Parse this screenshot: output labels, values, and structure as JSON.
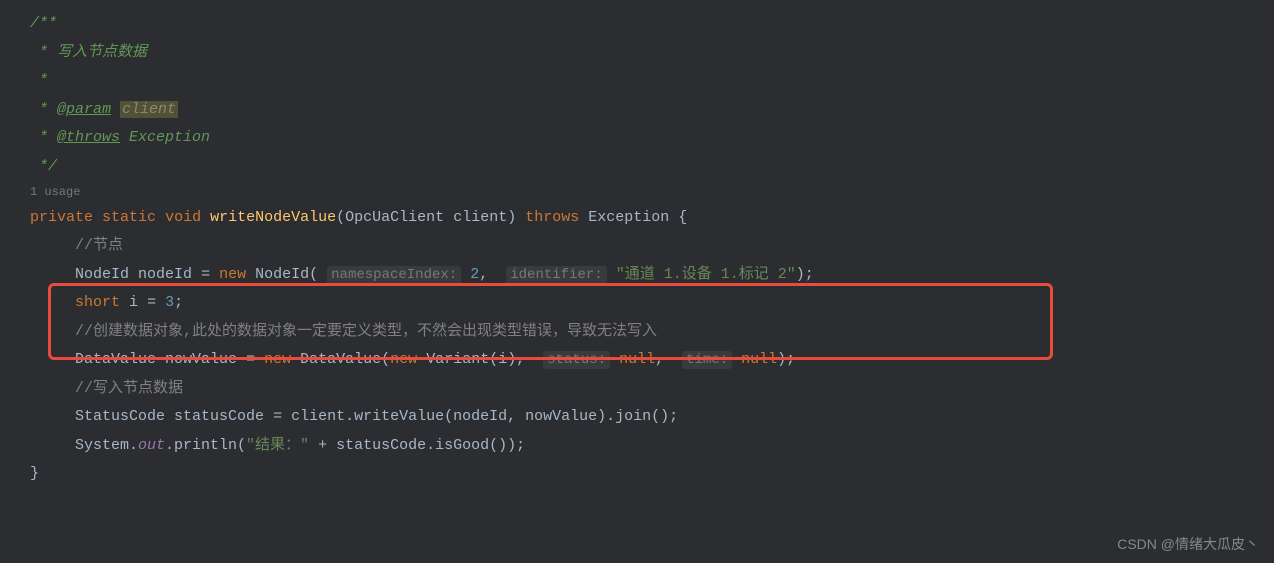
{
  "doc": {
    "open": "/**",
    "line1_star": " * ",
    "line1_text": "写入节点数据",
    "line2_star": " *",
    "line3_star": " * ",
    "param_tag": "@param",
    "param_name": "client",
    "line4_star": " * ",
    "throws_tag": "@throws",
    "throws_name": "Exception",
    "close": " */"
  },
  "usage": "1 usage",
  "method_sig": {
    "private": "private",
    "static": "static",
    "void": "void",
    "name": "writeNodeValue",
    "paren_open": "(",
    "param_type": "OpcUaClient",
    "param_name": "client",
    "paren_close": ")",
    "throws": "throws",
    "exception": "Exception",
    "brace": "{"
  },
  "body": {
    "comment1": "//节点",
    "line2": {
      "type": "NodeId",
      "var": "nodeId",
      "eq": "=",
      "new": "new",
      "ctor": "NodeId",
      "hint1": "namespaceIndex:",
      "arg1": "2",
      "comma1": ",",
      "hint2": "identifier:",
      "arg2": "\"通道 1.设备 1.标记 2\"",
      "end": ");"
    },
    "line3": {
      "type": "short",
      "var": "i",
      "eq": "=",
      "val": "3",
      "semi": ";"
    },
    "comment2": "//创建数据对象,此处的数据对象一定要定义类型，不然会出现类型错误，导致无法写入",
    "line5": {
      "type": "DataValue",
      "var": "nowValue",
      "eq": "=",
      "new": "new",
      "ctor": "DataValue",
      "paren": "(",
      "new2": "new",
      "ctor2": "Variant",
      "args2": "(i)",
      "comma": ",",
      "hint1": "status:",
      "null1": "null",
      "comma2": ",",
      "hint2": "time:",
      "null2": "null",
      "end": ");"
    },
    "comment3": "//写入节点数据",
    "line7": {
      "type": "StatusCode",
      "var": "statusCode",
      "eq": "=",
      "rest": "client.writeValue(nodeId, nowValue).join();"
    },
    "line8": {
      "sys": "System.",
      "out": "out",
      "print": ".println(",
      "str": "\"结果：\"",
      "plus": " + statusCode.isGood());"
    },
    "close_brace": "}"
  },
  "watermark": "CSDN @情绪大瓜皮丶"
}
